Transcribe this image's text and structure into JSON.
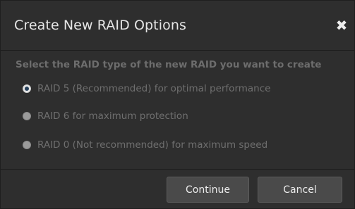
{
  "dialog": {
    "title": "Create New RAID Options",
    "close_glyph": "✖",
    "prompt": "Select the RAID type of the new RAID you want to create",
    "options": [
      {
        "label": "RAID 5 (Recommended) for optimal performance",
        "selected": true
      },
      {
        "label": "RAID 6 for maximum protection",
        "selected": false
      },
      {
        "label": "RAID 0 (Not recommended) for maximum speed",
        "selected": false
      }
    ],
    "buttons": {
      "continue_label": "Continue",
      "cancel_label": "Cancel"
    }
  },
  "colors": {
    "background": "#2e2e2e",
    "title_text": "#e6e6e6",
    "muted_text": "#6f6f6f",
    "button_bg": "#4a4a4a"
  }
}
